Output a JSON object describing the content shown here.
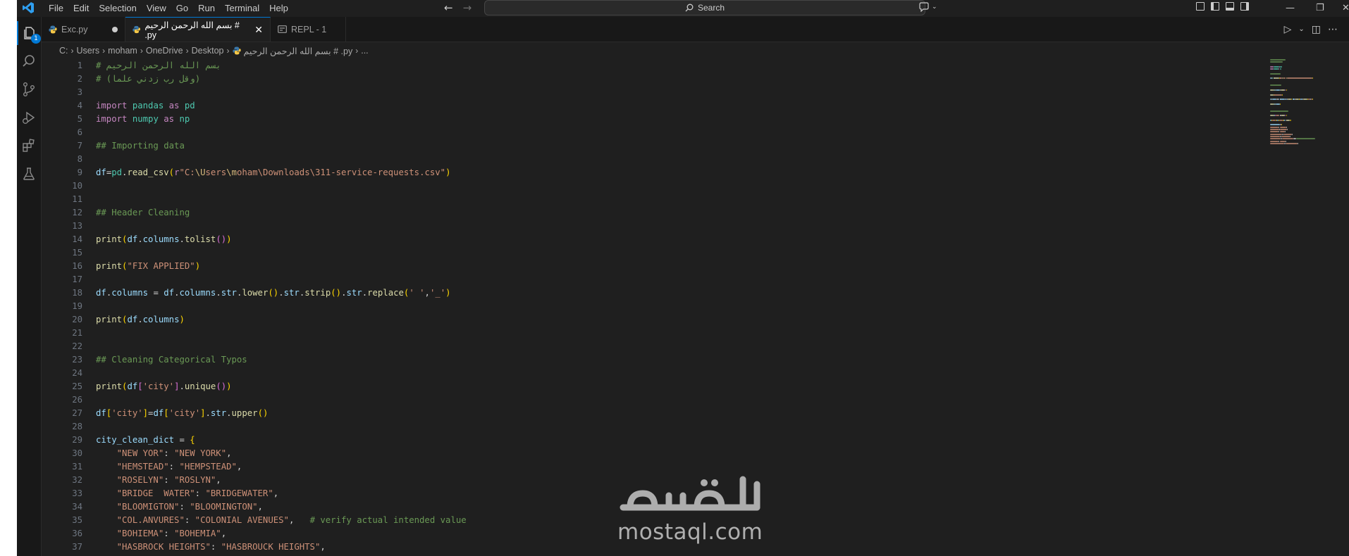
{
  "menu": [
    "File",
    "Edit",
    "Selection",
    "View",
    "Go",
    "Run",
    "Terminal",
    "Help"
  ],
  "search": {
    "label": "Search"
  },
  "activity": {
    "explorer_badge": "1"
  },
  "tabs": [
    {
      "label": "Exc.py",
      "modified": true
    },
    {
      "label": "بسم الله الرحمن الرحيم # .py",
      "active": true
    },
    {
      "label": "REPL - 1"
    }
  ],
  "breadcrumb": [
    "C:",
    "Users",
    "moham",
    "OneDrive",
    "Desktop",
    "بسم الله الرحمن الرحيم # .py",
    "..."
  ],
  "code_lines": [
    [
      [
        "# بسم الله الرحمن الرحيم",
        "k-cmt"
      ]
    ],
    [
      [
        "# (وقل رب زدني علما)",
        "k-cmt"
      ]
    ],
    [],
    [
      [
        "import",
        "k-kw"
      ],
      [
        " pandas ",
        "k-mod"
      ],
      [
        "as",
        "k-kw"
      ],
      [
        " pd",
        "k-mod"
      ]
    ],
    [
      [
        "import",
        "k-kw"
      ],
      [
        " numpy ",
        "k-mod"
      ],
      [
        "as",
        "k-kw"
      ],
      [
        " np",
        "k-mod"
      ]
    ],
    [],
    [
      [
        "## Importing data",
        "k-cmt"
      ]
    ],
    [],
    [
      [
        "df",
        "k-var"
      ],
      [
        "=",
        "k-op"
      ],
      [
        "pd",
        "k-mod"
      ],
      [
        ".",
        "k-op"
      ],
      [
        "read_csv",
        "k-fn"
      ],
      [
        "(",
        "k-p1"
      ],
      [
        "r",
        "k-kw"
      ],
      [
        "\"C:",
        "k-str"
      ],
      [
        "\\U",
        "k-esc"
      ],
      [
        "sers",
        "k-str"
      ],
      [
        "\\m",
        "k-esc"
      ],
      [
        "oham\\Downloads\\311-service-requests.csv\"",
        "k-str"
      ],
      [
        ")",
        "k-p1"
      ]
    ],
    [],
    [],
    [
      [
        "## Header Cleaning",
        "k-cmt"
      ]
    ],
    [],
    [
      [
        "print",
        "k-fn"
      ],
      [
        "(",
        "k-p1"
      ],
      [
        "df",
        "k-var"
      ],
      [
        ".",
        "k-op"
      ],
      [
        "columns",
        "k-var"
      ],
      [
        ".",
        "k-op"
      ],
      [
        "tolist",
        "k-fn"
      ],
      [
        "()",
        "k-p2"
      ],
      [
        ")",
        "k-p1"
      ]
    ],
    [],
    [
      [
        "print",
        "k-fn"
      ],
      [
        "(",
        "k-p1"
      ],
      [
        "\"FIX APPLIED\"",
        "k-str"
      ],
      [
        ")",
        "k-p1"
      ]
    ],
    [],
    [
      [
        "df",
        "k-var"
      ],
      [
        ".",
        "k-op"
      ],
      [
        "columns",
        "k-var"
      ],
      [
        " = ",
        "k-op"
      ],
      [
        "df",
        "k-var"
      ],
      [
        ".",
        "k-op"
      ],
      [
        "columns",
        "k-var"
      ],
      [
        ".",
        "k-op"
      ],
      [
        "str",
        "k-var"
      ],
      [
        ".",
        "k-op"
      ],
      [
        "lower",
        "k-fn"
      ],
      [
        "()",
        "k-p1"
      ],
      [
        ".",
        "k-op"
      ],
      [
        "str",
        "k-var"
      ],
      [
        ".",
        "k-op"
      ],
      [
        "strip",
        "k-fn"
      ],
      [
        "()",
        "k-p1"
      ],
      [
        ".",
        "k-op"
      ],
      [
        "str",
        "k-var"
      ],
      [
        ".",
        "k-op"
      ],
      [
        "replace",
        "k-fn"
      ],
      [
        "(",
        "k-p1"
      ],
      [
        "' '",
        "k-str"
      ],
      [
        ",",
        "k-op"
      ],
      [
        "'_'",
        "k-str"
      ],
      [
        ")",
        "k-p1"
      ]
    ],
    [],
    [
      [
        "print",
        "k-fn"
      ],
      [
        "(",
        "k-p1"
      ],
      [
        "df",
        "k-var"
      ],
      [
        ".",
        "k-op"
      ],
      [
        "columns",
        "k-var"
      ],
      [
        ")",
        "k-p1"
      ]
    ],
    [],
    [],
    [
      [
        "## Cleaning Categorical Typos",
        "k-cmt"
      ]
    ],
    [],
    [
      [
        "print",
        "k-fn"
      ],
      [
        "(",
        "k-p1"
      ],
      [
        "df",
        "k-var"
      ],
      [
        "[",
        "k-p2"
      ],
      [
        "'city'",
        "k-str"
      ],
      [
        "]",
        "k-p2"
      ],
      [
        ".",
        "k-op"
      ],
      [
        "unique",
        "k-fn"
      ],
      [
        "()",
        "k-p2"
      ],
      [
        ")",
        "k-p1"
      ]
    ],
    [],
    [
      [
        "df",
        "k-var"
      ],
      [
        "[",
        "k-p1"
      ],
      [
        "'city'",
        "k-str"
      ],
      [
        "]",
        "k-p1"
      ],
      [
        "=",
        "k-op"
      ],
      [
        "df",
        "k-var"
      ],
      [
        "[",
        "k-p1"
      ],
      [
        "'city'",
        "k-str"
      ],
      [
        "]",
        "k-p1"
      ],
      [
        ".",
        "k-op"
      ],
      [
        "str",
        "k-var"
      ],
      [
        ".",
        "k-op"
      ],
      [
        "upper",
        "k-fn"
      ],
      [
        "()",
        "k-p1"
      ]
    ],
    [],
    [
      [
        "city_clean_dict",
        "k-var"
      ],
      [
        " = ",
        "k-op"
      ],
      [
        "{",
        "k-p1"
      ]
    ],
    [
      [
        "    \"NEW YOR\"",
        "k-str"
      ],
      [
        ": ",
        "k-op"
      ],
      [
        "\"NEW YORK\"",
        "k-str"
      ],
      [
        ",",
        "k-op"
      ]
    ],
    [
      [
        "    \"HEMSTEAD\"",
        "k-str"
      ],
      [
        ": ",
        "k-op"
      ],
      [
        "\"HEMPSTEAD\"",
        "k-str"
      ],
      [
        ",",
        "k-op"
      ]
    ],
    [
      [
        "    \"ROSELYN\"",
        "k-str"
      ],
      [
        ": ",
        "k-op"
      ],
      [
        "\"ROSLYN\"",
        "k-str"
      ],
      [
        ",",
        "k-op"
      ]
    ],
    [
      [
        "    \"BRIDGE  WATER\"",
        "k-str"
      ],
      [
        ": ",
        "k-op"
      ],
      [
        "\"BRIDGEWATER\"",
        "k-str"
      ],
      [
        ",",
        "k-op"
      ]
    ],
    [
      [
        "    \"BLOOMIGTON\"",
        "k-str"
      ],
      [
        ": ",
        "k-op"
      ],
      [
        "\"BLOOMINGTON\"",
        "k-str"
      ],
      [
        ",",
        "k-op"
      ]
    ],
    [
      [
        "    \"COL.ANVURES\"",
        "k-str"
      ],
      [
        ": ",
        "k-op"
      ],
      [
        "\"COLONIAL AVENUES\"",
        "k-str"
      ],
      [
        ",   ",
        "k-op"
      ],
      [
        "# verify actual intended value",
        "k-cmt"
      ]
    ],
    [
      [
        "    \"BOHIEMA\"",
        "k-str"
      ],
      [
        ": ",
        "k-op"
      ],
      [
        "\"BOHEMIA\"",
        "k-str"
      ],
      [
        ",",
        "k-op"
      ]
    ],
    [
      [
        "    \"HASBROCK HEIGHTS\"",
        "k-str"
      ],
      [
        ": ",
        "k-op"
      ],
      [
        "\"HASBROUCK HEIGHTS\"",
        "k-str"
      ],
      [
        ",",
        "k-op"
      ]
    ]
  ],
  "watermark": {
    "latin": "mostaql.com",
    "arabic": "مستقل"
  }
}
